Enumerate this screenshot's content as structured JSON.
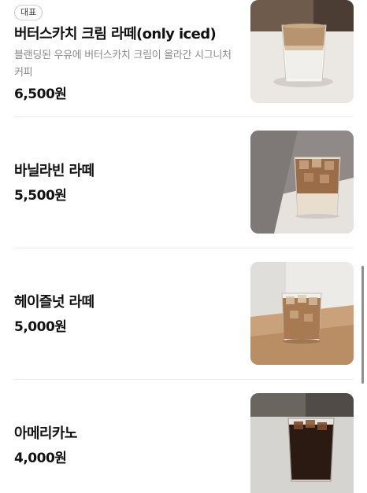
{
  "menu": {
    "items": [
      {
        "badge": "대표",
        "name": "버터스카치 크림 라떼(only iced)",
        "description": "블랜딩된 우유에 버터스카치 크림이 올라간 시그니처 커피",
        "price": "6,500원",
        "image_icon": "butterscotch-cream-latte-photo"
      },
      {
        "name": "바닐라빈 라떼",
        "price": "5,500원",
        "image_icon": "vanilla-bean-latte-photo"
      },
      {
        "name": "헤이즐넛 라떼",
        "price": "5,000원",
        "image_icon": "hazelnut-latte-photo"
      },
      {
        "name": "아메리카노",
        "price": "4,000원",
        "image_icon": "americano-photo"
      }
    ]
  },
  "colors": {
    "divider": "#ececec",
    "description_text": "#8a8a8a",
    "badge_border": "#cfcfcf"
  }
}
